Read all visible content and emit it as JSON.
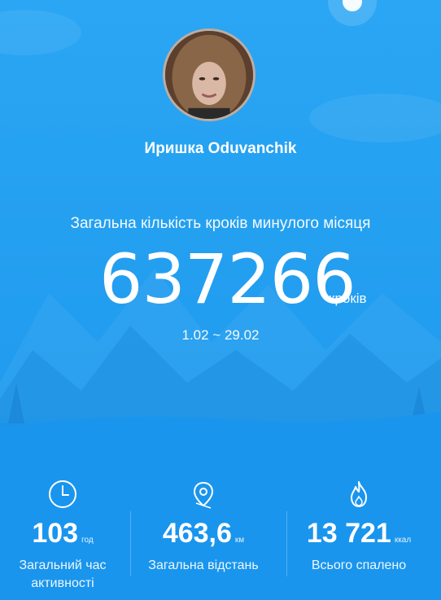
{
  "profile": {
    "name": "Иришка Oduvanchik"
  },
  "summary": {
    "title": "Загальна кількість кроків минулого місяця",
    "steps": "637266",
    "steps_unit": "кроків",
    "date_range": "1.02 ~ 29.02"
  },
  "stats": [
    {
      "icon": "clock-icon",
      "value": "103",
      "unit": "год",
      "label_line1": "Загальний час",
      "label_line2": "активності"
    },
    {
      "icon": "location-pin-icon",
      "value": "463,6",
      "unit": "км",
      "label_line1": "Загальна відстань",
      "label_line2": ""
    },
    {
      "icon": "flame-icon",
      "value": "13 721",
      "unit": "ккал",
      "label_line1": "Всього спалено",
      "label_line2": ""
    }
  ],
  "colors": {
    "background": "#1e9cf0",
    "text": "#ffffff"
  }
}
